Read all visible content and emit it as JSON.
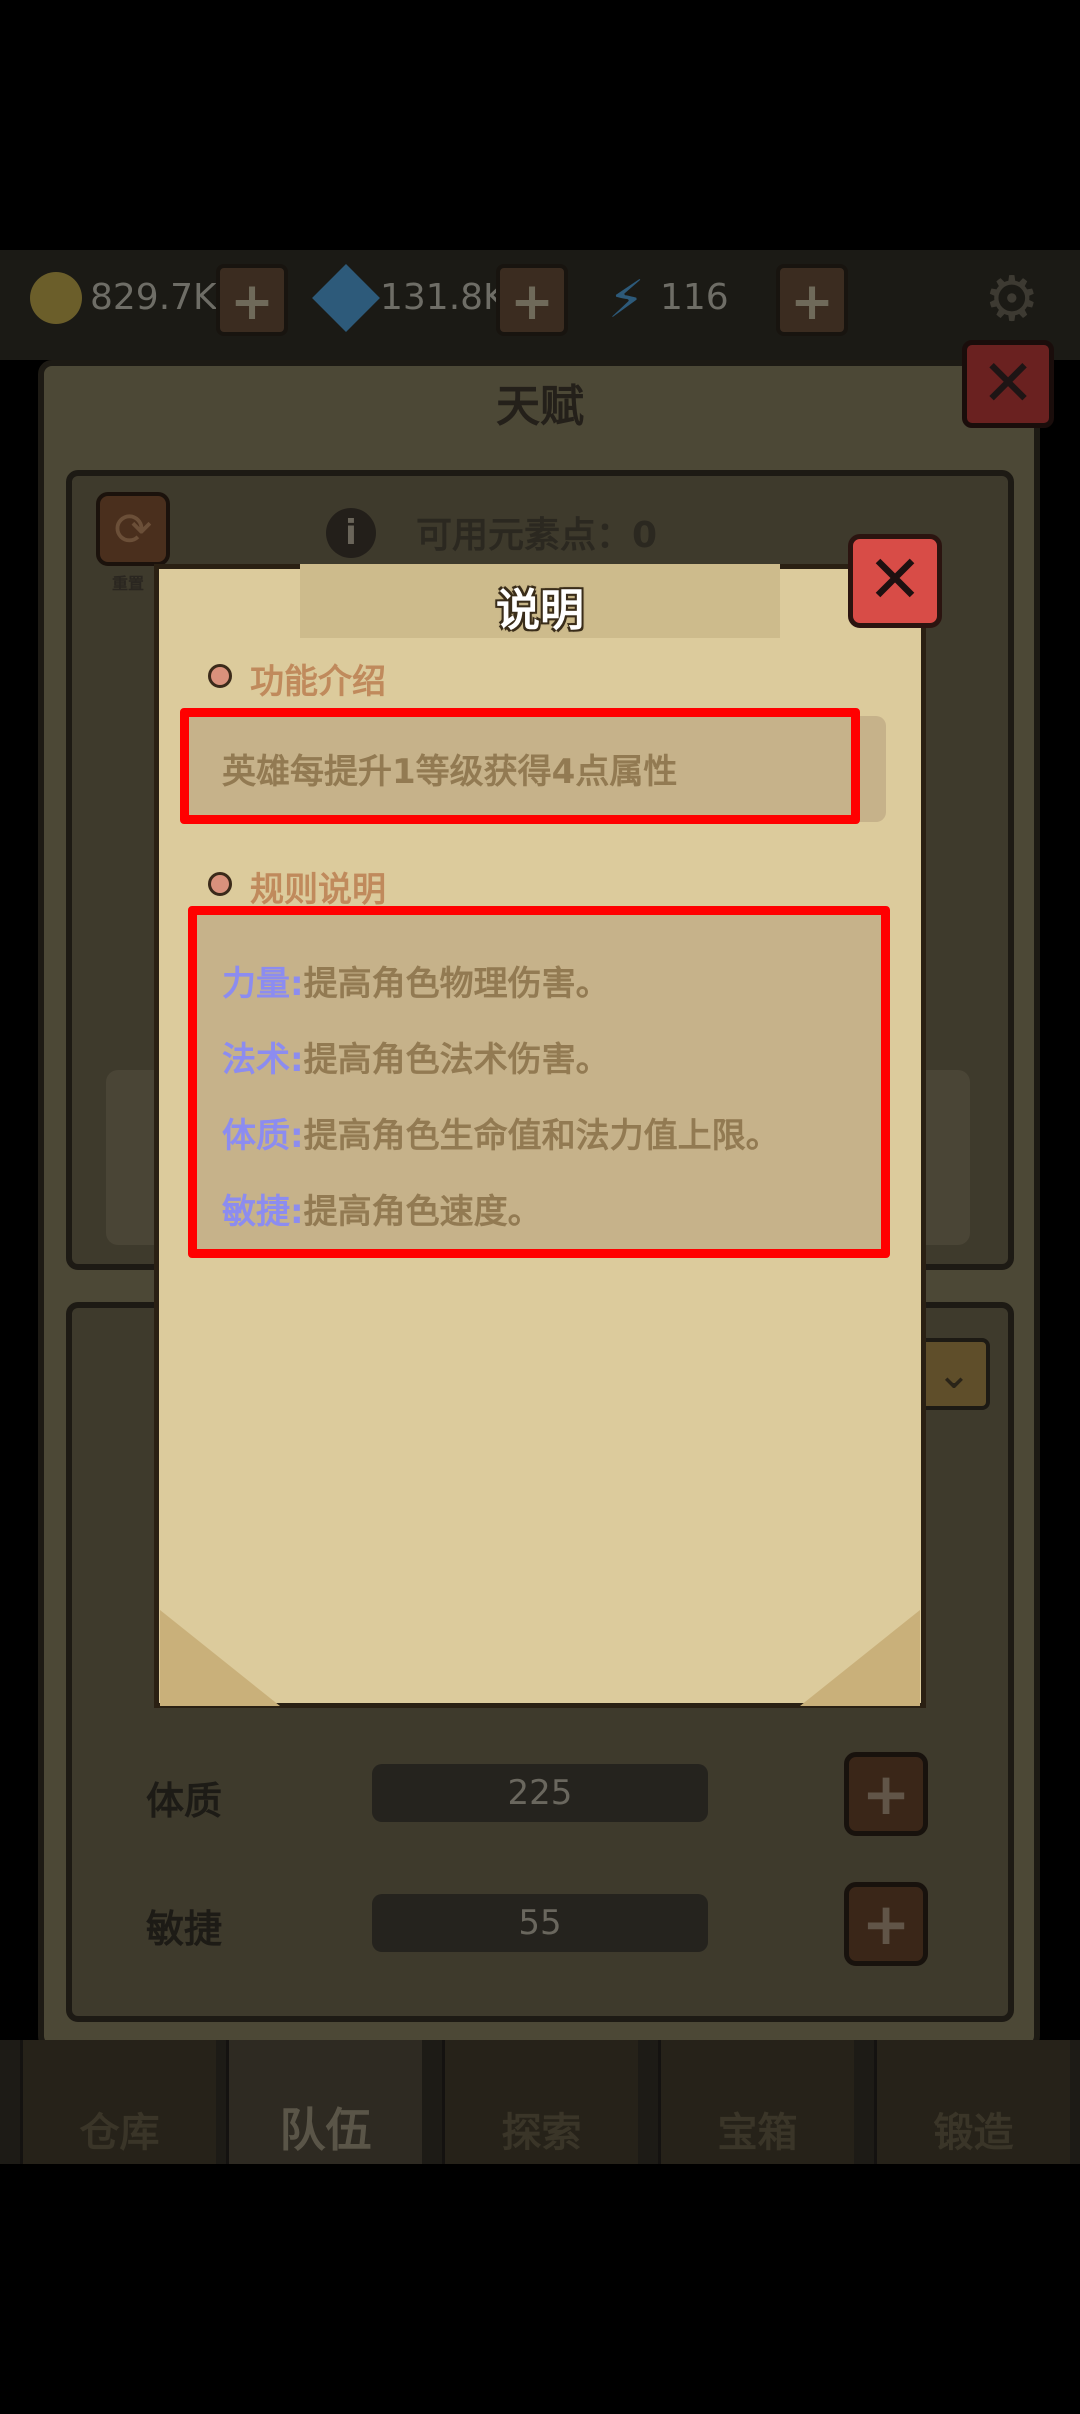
{
  "resources": {
    "gold": {
      "value": "829.7K",
      "icon": "gold-coin-icon",
      "color": "#6b5e2a"
    },
    "gems": {
      "value": "131.8K",
      "icon": "diamond-icon",
      "color": "#2d5a7a"
    },
    "energy": {
      "value": "116",
      "icon": "lightning-icon",
      "color": "#2d5a7a"
    }
  },
  "background_dialog": {
    "title": "天赋",
    "available_points_label": "可用元素点：0",
    "reset_label": "重置",
    "stats": [
      {
        "label": "体质",
        "value": "225"
      },
      {
        "label": "敏捷",
        "value": "55"
      }
    ]
  },
  "bottom_nav": {
    "items": [
      {
        "label": "仓库",
        "active": false
      },
      {
        "label": "队伍",
        "active": true
      },
      {
        "label": "探索",
        "active": false
      },
      {
        "label": "宝箱",
        "active": false
      },
      {
        "label": "锻造",
        "active": false
      }
    ]
  },
  "info_dialog": {
    "title": "说明",
    "close_icon": "close-x-icon",
    "feature_section": {
      "heading": "功能介绍",
      "text": "英雄每提升1等级获得4点属性"
    },
    "rules_section": {
      "heading": "规则说明",
      "rules": [
        {
          "key": "力量:",
          "desc": "提高角色物理伤害。"
        },
        {
          "key": "法术:",
          "desc": "提高角色法术伤害。"
        },
        {
          "key": "体质:",
          "desc": "提高角色生命值和法力值上限。"
        },
        {
          "key": "敏捷:",
          "desc": "提高角色速度。"
        }
      ]
    }
  },
  "colors": {
    "scroll_bg": "#dccb9c",
    "highlight_frame": "#ff0000",
    "rule_key": "#8c8cf0",
    "rule_text": "#927a52",
    "close_button": "#d84c47"
  }
}
